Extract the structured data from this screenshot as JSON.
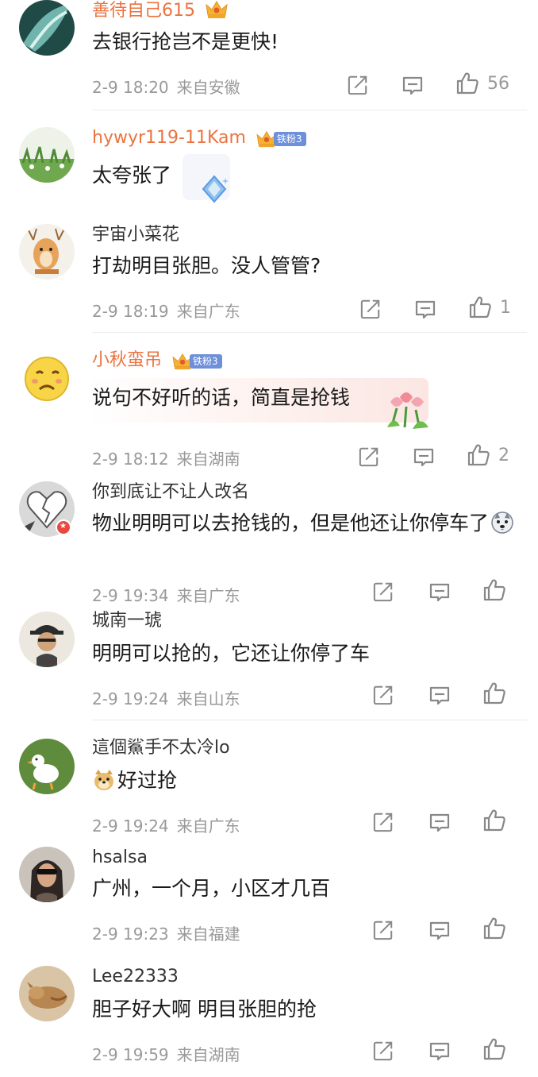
{
  "comments": [
    {
      "username": "善待自己615",
      "text": "去银行抢岂不是更快!",
      "date": "2-9 18:20",
      "location": "来自安徽",
      "likes": "56"
    },
    {
      "username": "hywyr119-11Kam",
      "fan_label": "铁粉3",
      "text": "太夸张了",
      "date": "",
      "location": "",
      "likes": ""
    },
    {
      "username": "宇宙小菜花",
      "text": "打劫明目张胆。没人管管?",
      "date": "2-9 18:19",
      "location": "来自广东",
      "likes": "1"
    },
    {
      "username": "小秋蛮吊",
      "fan_label": "铁粉3",
      "text": "说句不好听的话，简直是抢钱",
      "date": "2-9 18:12",
      "location": "来自湖南",
      "likes": "2"
    },
    {
      "username": "你到底让不让人改名",
      "text": "物业明明可以去抢钱的，但是他还让你停车了",
      "date": "2-9 19:34",
      "location": "来自广东",
      "likes": ""
    },
    {
      "username": "城南一琥",
      "text": "明明可以抢的，它还让你停了车",
      "date": "2-9 19:24",
      "location": "来自山东",
      "likes": ""
    },
    {
      "username": "這個鯊手不太冷lo",
      "text": "好过抢",
      "date": "2-9 19:24",
      "location": "来自广东",
      "likes": ""
    },
    {
      "username": "hsalsa",
      "text": "广州，一个月，小区才几百",
      "date": "2-9 19:23",
      "location": "来自福建",
      "likes": ""
    },
    {
      "username": "Lee22333",
      "text": "胆子好大啊 明目张胆的抢",
      "date": "2-9 19:59",
      "location": "来自湖南",
      "likes": ""
    }
  ],
  "colors": {
    "vip_name": "#eb7340",
    "name": "#333333",
    "meta": "#999999",
    "fan_badge": "#6e8fd9"
  },
  "icons": {
    "share": "edit-share-icon",
    "comment": "comment-bubble-icon",
    "like": "thumbs-up-icon"
  }
}
